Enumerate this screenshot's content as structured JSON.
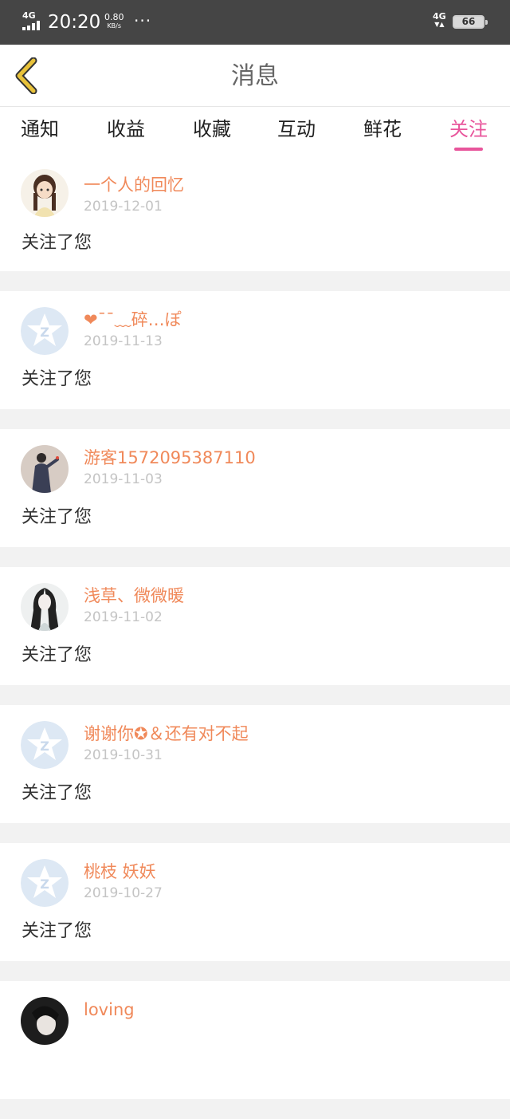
{
  "status_bar": {
    "network": "4G",
    "time": "20:20",
    "speed_value": "0.80",
    "speed_unit": "KB/s",
    "more": "···",
    "network2": "4G",
    "network2_arrows": "▼▲",
    "battery": "66"
  },
  "header": {
    "title": "消息"
  },
  "tabs": [
    {
      "label": "通知"
    },
    {
      "label": "收益"
    },
    {
      "label": "收藏"
    },
    {
      "label": "互动"
    },
    {
      "label": "鲜花"
    },
    {
      "label": "关注",
      "active": true
    }
  ],
  "notifications": [
    {
      "name": "一个人的回忆",
      "date": "2019-12-01",
      "action": "关注了您",
      "avatar": "girl-portrait"
    },
    {
      "name": "❤ˉˉ﹏碎…ぽ",
      "date": "2019-11-13",
      "action": "关注了您",
      "avatar": "default-z-avatar"
    },
    {
      "name": "游客1572095387110",
      "date": "2019-11-03",
      "action": "关注了您",
      "avatar": "person-photo"
    },
    {
      "name": "浅草、微微暖",
      "date": "2019-11-02",
      "action": "关注了您",
      "avatar": "ink-portrait"
    },
    {
      "name": "谢谢你✪＆还有对不起",
      "date": "2019-10-31",
      "action": "关注了您",
      "avatar": "default-z-avatar"
    },
    {
      "name": "桃枝 妖妖",
      "date": "2019-10-27",
      "action": "关注了您",
      "avatar": "default-z-avatar"
    },
    {
      "name": "loving",
      "date": "",
      "action": "",
      "avatar": "dark-portrait"
    }
  ],
  "colors": {
    "accent": "#e8559b",
    "username": "#f0895a",
    "back_arrow": "#e8c23a"
  }
}
